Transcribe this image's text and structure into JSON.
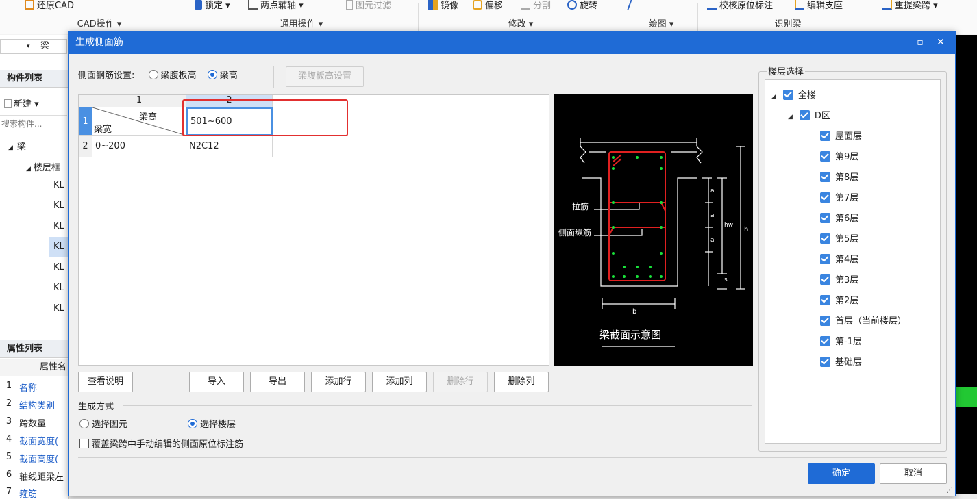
{
  "ribbon": {
    "buttons": [
      {
        "label": "还原CAD",
        "icon": "restore-cad-icon"
      },
      {
        "label": "锁定",
        "icon": "lock-icon"
      },
      {
        "label": "两点辅轴",
        "icon": "axis-icon"
      },
      {
        "label": "图元过滤",
        "icon": "filter-icon"
      },
      {
        "label": "镜像",
        "icon": "mirror-icon"
      },
      {
        "label": "偏移",
        "icon": "offset-icon"
      },
      {
        "label": "分割",
        "icon": "split-icon"
      },
      {
        "label": "旋转",
        "icon": "rotate-icon"
      },
      {
        "label": "校核原位标注",
        "icon": "check-icon"
      },
      {
        "label": "编辑支座",
        "icon": "edit-support-icon"
      },
      {
        "label": "重提梁跨",
        "icon": "beam-span-icon"
      }
    ],
    "groups": {
      "cad": "CAD操作 ▾",
      "general": "通用操作 ▾",
      "modify": "修改 ▾",
      "draw": "绘图 ▾",
      "identify": "识别梁"
    }
  },
  "left": {
    "combo_value": "梁",
    "component_list_title": "构件列表",
    "new_label": "新建",
    "search_placeholder": "搜索构件...",
    "tree_root": "梁",
    "tree_sub": "楼层框",
    "items": [
      "KL",
      "KL",
      "KL",
      "KL",
      "KL",
      "KL",
      "KL"
    ],
    "property_list_title": "属性列表",
    "property_header": "属性名",
    "properties": [
      {
        "no": "1",
        "name": "名称",
        "blue": true
      },
      {
        "no": "2",
        "name": "结构类别",
        "blue": true
      },
      {
        "no": "3",
        "name": "跨数量",
        "blue": false
      },
      {
        "no": "4",
        "name": "截面宽度(",
        "blue": true
      },
      {
        "no": "5",
        "name": "截面高度(",
        "blue": true
      },
      {
        "no": "6",
        "name": "轴线距梁左",
        "blue": false
      },
      {
        "no": "7",
        "name": "箍筋",
        "blue": true
      }
    ]
  },
  "dialog": {
    "title": "生成侧面筋",
    "side_rebar_setting_label": "侧面钢筋设置:",
    "opt_web_height": "梁腹板高",
    "opt_beam_height": "梁高",
    "web_height_setting_btn": "梁腹板高设置",
    "grid": {
      "col_headers": [
        "1",
        "2"
      ],
      "row_headers": [
        "1",
        "2"
      ],
      "corner_top": "梁高",
      "corner_bottom": "梁宽",
      "header_value": "501~600",
      "rows": [
        {
          "width": "0~200",
          "rebar": "N2C12"
        }
      ]
    },
    "diagram": {
      "caption": "梁截面示意图",
      "label_tie": "拉筋",
      "label_side": "侧面纵筋",
      "dim_a": "a",
      "dim_hw": "hw",
      "dim_h": "h",
      "dim_s": "s",
      "dim_b": "b"
    },
    "buttons": {
      "view_help": "查看说明",
      "import": "导入",
      "export": "导出",
      "add_row": "添加行",
      "add_col": "添加列",
      "delete_row": "删除行",
      "delete_col": "删除列",
      "ok": "确定",
      "cancel": "取消"
    },
    "generation": {
      "label": "生成方式",
      "opt_select_element": "选择图元",
      "opt_select_floor": "选择楼层",
      "overwrite_label": "覆盖梁跨中手动编辑的侧面原位标注筋"
    },
    "floor": {
      "label": "楼层选择",
      "all": "全楼",
      "zone": "D区",
      "floors": [
        "屋面层",
        "第9层",
        "第8层",
        "第7层",
        "第6层",
        "第5层",
        "第4层",
        "第3层",
        "第2层",
        "首层（当前楼层）",
        "第-1层",
        "基础层"
      ]
    }
  },
  "colors": {
    "accent": "#1f6bd6",
    "highlight_box": "#e23030",
    "rebar": "#e02020",
    "rebar_dot": "#19e03a"
  }
}
